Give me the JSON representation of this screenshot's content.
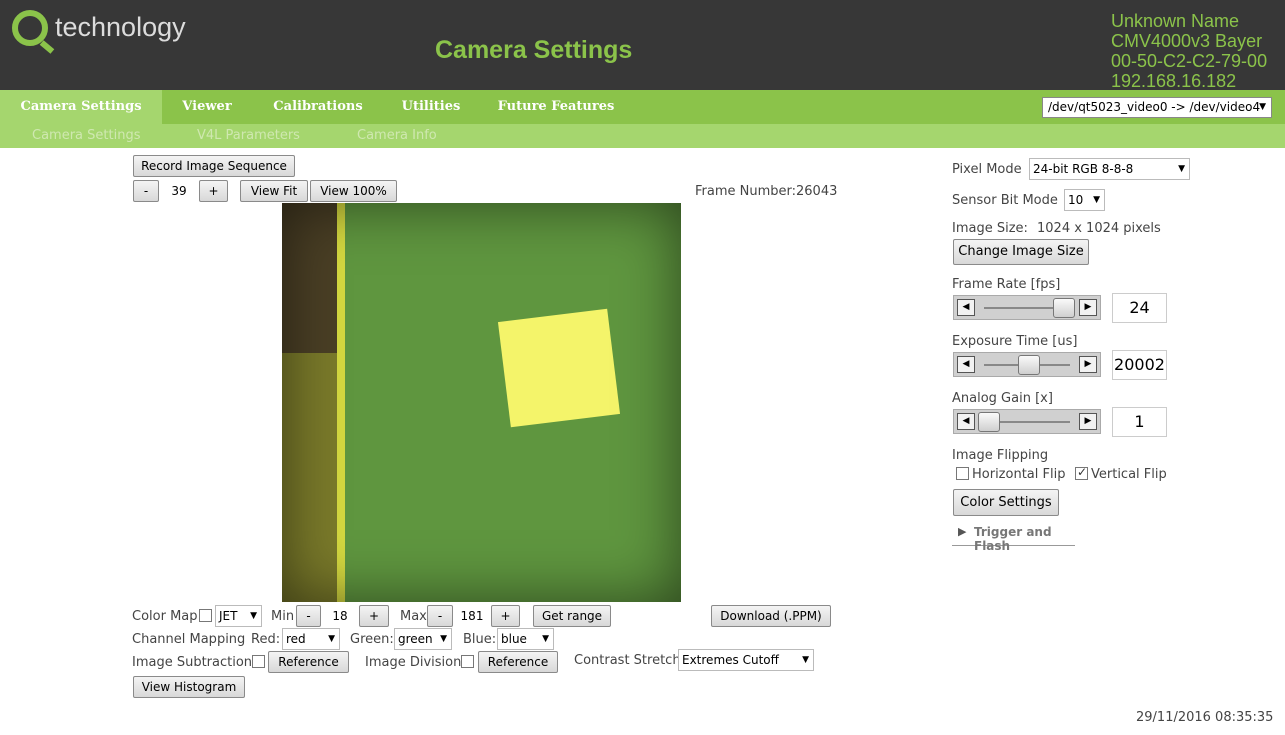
{
  "header": {
    "logo_text": "technology",
    "page_title": "Camera Settings",
    "device_name": "Unknown Name",
    "sensor": "CMV4000v3 Bayer",
    "mac": "00-50-C2-C2-79-00",
    "ip": "192.168.16.182"
  },
  "nav": {
    "tabs": [
      "Camera Settings",
      "Viewer",
      "Calibrations",
      "Utilities",
      "Future Features"
    ],
    "active": "Camera Settings",
    "device_select": "/dev/qt5023_video0 -> /dev/video4"
  },
  "subnav": [
    "Camera Settings",
    "V4L Parameters",
    "Camera Info"
  ],
  "viewer": {
    "record_label": "Record Image Sequence",
    "minus": "-",
    "plus": "+",
    "zoom_value": "39",
    "view_fit": "View Fit",
    "view_100": "View 100%",
    "frame_number": "Frame Number:26043"
  },
  "controls": {
    "color_map_label": "Color Map",
    "color_map_value": "JET",
    "min_label": "Min",
    "min_value": "18",
    "max_label": "Max",
    "max_value": "181",
    "get_range": "Get range",
    "download": "Download (.PPM)",
    "channel_mapping_label": "Channel Mapping",
    "red_label": "Red:",
    "red_value": "red",
    "green_label": "Green:",
    "green_value": "green",
    "blue_label": "Blue:",
    "blue_value": "blue",
    "subtraction_label": "Image Subtraction",
    "reference": "Reference",
    "division_label": "Image Division",
    "contrast_label": "Contrast Stretch",
    "contrast_value": "Extremes Cutoff",
    "histogram": "View Histogram"
  },
  "settings": {
    "pixel_mode_label": "Pixel Mode",
    "pixel_mode_value": "24-bit RGB 8-8-8",
    "sensor_bit_label": "Sensor Bit Mode",
    "sensor_bit_value": "10",
    "image_size_label": "Image Size:",
    "image_size_value": "1024 x 1024 pixels",
    "change_size": "Change Image Size",
    "frame_rate_label": "Frame Rate [fps]",
    "frame_rate_value": "24",
    "frame_rate_pos": 0.85,
    "exposure_label": "Exposure Time [us]",
    "exposure_value": "20002",
    "exposure_pos": 0.45,
    "gain_label": "Analog Gain [x]",
    "gain_value": "1",
    "gain_pos": 0.0,
    "flipping_label": "Image Flipping",
    "horizontal_flip": "Horizontal Flip",
    "vertical_flip": "Vertical Flip",
    "horizontal_flip_checked": false,
    "vertical_flip_checked": true,
    "color_settings": "Color Settings",
    "trigger_flash": "Trigger and Flash"
  },
  "timestamp": "29/11/2016 08:35:35",
  "colors": {
    "brand_green": "#8bc34a",
    "header_bg": "#373737",
    "subnav_bg": "#a5d66e"
  }
}
